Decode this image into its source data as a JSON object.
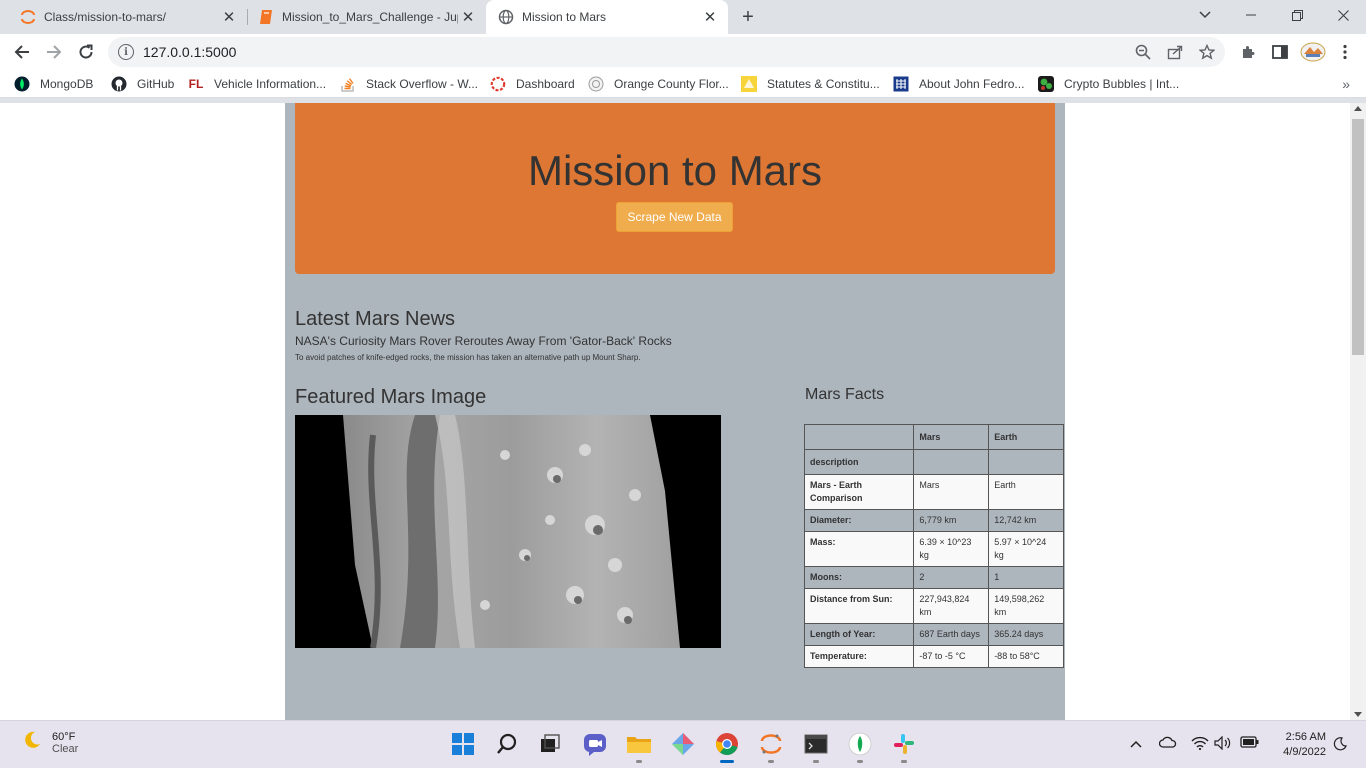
{
  "browser": {
    "tabs": [
      {
        "title": "Class/mission-to-mars/",
        "icon": "jupyter-icon",
        "active": false
      },
      {
        "title": "Mission_to_Mars_Challenge - Jup",
        "icon": "notebook-icon",
        "active": false
      },
      {
        "title": "Mission to Mars",
        "icon": "globe-icon",
        "active": true
      }
    ],
    "url": "127.0.0.1:5000",
    "bookmarks": [
      {
        "label": "MongoDB",
        "icon": "mongodb-leaf-icon"
      },
      {
        "label": "GitHub",
        "icon": "github-icon"
      },
      {
        "label": "Vehicle Information...",
        "icon": "flhsmv-icon"
      },
      {
        "label": "Stack Overflow - W...",
        "icon": "stackoverflow-icon"
      },
      {
        "label": "Dashboard",
        "icon": "dashboard-icon"
      },
      {
        "label": "Orange County Flor...",
        "icon": "county-seal-icon"
      },
      {
        "label": "Statutes & Constitu...",
        "icon": "statutes-icon"
      },
      {
        "label": "About John Fedro...",
        "icon": "grid-icon"
      },
      {
        "label": "Crypto Bubbles | Int...",
        "icon": "crypto-bubbles-icon"
      }
    ]
  },
  "page": {
    "title": "Mission to Mars",
    "scrape_button": "Scrape New Data",
    "news": {
      "heading": "Latest Mars News",
      "title": "NASA's Curiosity Mars Rover Reroutes Away From 'Gator-Back' Rocks",
      "paragraph": "To avoid patches of knife-edged rocks, the mission has taken an alternative path up Mount Sharp."
    },
    "featured_image": {
      "heading": "Featured Mars Image"
    },
    "facts": {
      "heading": "Mars Facts",
      "columns": [
        "",
        "Mars",
        "Earth"
      ],
      "rows": [
        [
          "description",
          "",
          ""
        ],
        [
          "Mars - Earth Comparison",
          "Mars",
          "Earth"
        ],
        [
          "Diameter:",
          "6,779 km",
          "12,742 km"
        ],
        [
          "Mass:",
          "6.39 × 10^23 kg",
          "5.97 × 10^24 kg"
        ],
        [
          "Moons:",
          "2",
          "1"
        ],
        [
          "Distance from Sun:",
          "227,943,824 km",
          "149,598,262 km"
        ],
        [
          "Length of Year:",
          "687 Earth days",
          "365.24 days"
        ],
        [
          "Temperature:",
          "-87 to -5 °C",
          "-88 to 58°C"
        ]
      ]
    }
  },
  "taskbar": {
    "weather_temp": "60°F",
    "weather_cond": "Clear",
    "time": "2:56 AM",
    "date": "4/9/2022"
  },
  "colors": {
    "jumbotron": "#dd7733",
    "container": "#adb5bd",
    "button": "#f0ad4e"
  }
}
